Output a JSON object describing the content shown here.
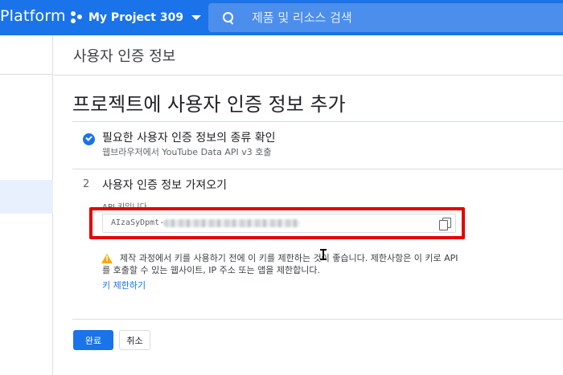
{
  "topbar": {
    "brand": "Platform",
    "project_name": "My Project 309",
    "search_placeholder": "제품 및 리소스 검색"
  },
  "page": {
    "section_title": "사용자 인증 정보",
    "main_title": "프로젝트에 사용자 인증 정보 추가"
  },
  "step1": {
    "title": "필요한 사용자 인증 정보의 종류 확인",
    "subtitle": "웹브라우저에서 YouTube Data API v3 호출"
  },
  "step2": {
    "number": "2",
    "title": "사용자 인증 정보 가져오기",
    "api_key_label": "API 키입니다.",
    "api_key_visible": "AIzaSyDpmt-"
  },
  "warning": {
    "text": "제작 과정에서 키를 사용하기 전에 이 키를 제한하는 것이 좋습니다. 제한사항은 이 키로 API를 호출할 수 있는 웹사이트, IP 주소 또는 앱을 제한합니다.",
    "link": "키 제한하기"
  },
  "buttons": {
    "done": "완료",
    "cancel": "취소"
  },
  "colors": {
    "brand_blue": "#1a73e8",
    "highlight_red": "#e60000",
    "warning_yellow": "#f9ab00"
  }
}
